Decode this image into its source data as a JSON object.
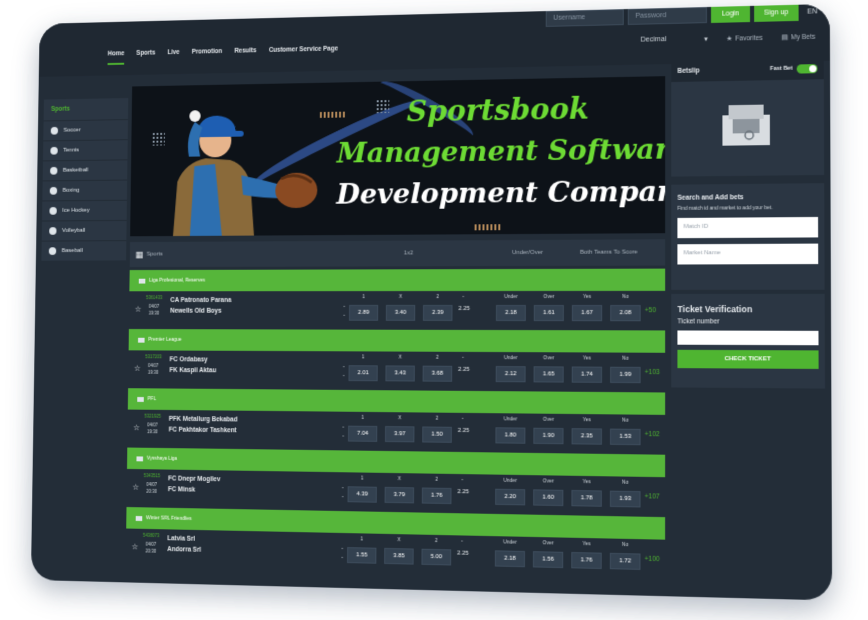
{
  "header": {
    "username_placeholder": "Username",
    "password_placeholder": "Password",
    "login_label": "Login",
    "signup_label": "Sign up",
    "lang": "EN",
    "nav": [
      "Home",
      "Sports",
      "Live",
      "Promotion",
      "Results",
      "Customer Service Page"
    ],
    "odds_format": "Decimal",
    "favorites_label": "Favorites",
    "mybets_label": "My Bets"
  },
  "sidebar": {
    "title": "Sports",
    "items": [
      {
        "label": "Soccer",
        "icon": "soccer-ball-icon"
      },
      {
        "label": "Tennis",
        "icon": "tennis-ball-icon"
      },
      {
        "label": "Basketball",
        "icon": "basketball-icon"
      },
      {
        "label": "Boxing",
        "icon": "boxing-glove-icon"
      },
      {
        "label": "Ice Hockey",
        "icon": "hockey-icon"
      },
      {
        "label": "Volleyball",
        "icon": "volleyball-icon"
      },
      {
        "label": "Baseball",
        "icon": "baseball-icon"
      }
    ]
  },
  "banner": {
    "line1": "Sportsbook",
    "line2": "Management Software",
    "line3": "Development Company"
  },
  "table": {
    "sports_label": "Sports",
    "col_1x2": "1x2",
    "col_under_over": "Under/Over",
    "col_both": "Both Teams To Score",
    "odd_labels": [
      "1",
      "X",
      "2"
    ],
    "uo_labels": [
      "Under",
      "Over"
    ],
    "bt_labels": [
      "Yes",
      "No"
    ],
    "matches": [
      {
        "league": "Liga Profesional, Reserves",
        "code": "5361433",
        "date": "04/07",
        "time": "19:30",
        "home": "CA Patronato Parana",
        "away": "Newells Old Boys",
        "o1": "2.89",
        "ox": "3.40",
        "o2": "2.39",
        "line": "2.25",
        "under": "2.18",
        "over": "1.61",
        "yes": "1.67",
        "no": "2.08",
        "more": "+50"
      },
      {
        "league": "Premier League",
        "code": "5317203",
        "date": "04/07",
        "time": "19:30",
        "home": "FC Ordabasy",
        "away": "FK Kaspii Aktau",
        "o1": "2.01",
        "ox": "3.43",
        "o2": "3.68",
        "line": "2.25",
        "under": "2.12",
        "over": "1.65",
        "yes": "1.74",
        "no": "1.99",
        "more": "+103"
      },
      {
        "league": "PFL",
        "code": "5321925",
        "date": "04/07",
        "time": "19:30",
        "home": "PFK Metallurg Bekabad",
        "away": "FC Pakhtakor Tashkent",
        "o1": "7.04",
        "ox": "3.97",
        "o2": "1.50",
        "line": "2.25",
        "under": "1.80",
        "over": "1.90",
        "yes": "2.35",
        "no": "1.53",
        "more": "+102"
      },
      {
        "league": "Vysshaya Liga",
        "code": "5343515",
        "date": "04/07",
        "time": "20:30",
        "home": "FC Dnepr Mogilev",
        "away": "FC Minsk",
        "o1": "4.39",
        "ox": "3.79",
        "o2": "1.76",
        "line": "2.25",
        "under": "2.20",
        "over": "1.60",
        "yes": "1.78",
        "no": "1.93",
        "more": "+107"
      },
      {
        "league": "Winter SRL Friendlies",
        "code": "5438073",
        "date": "04/07",
        "time": "20:30",
        "home": "Latvia Srl",
        "away": "Andorra Srl",
        "o1": "1.55",
        "ox": "3.85",
        "o2": "5.00",
        "line": "2.25",
        "under": "2.18",
        "over": "1.56",
        "yes": "1.76",
        "no": "1.72",
        "more": "+100"
      }
    ]
  },
  "betslip": {
    "title": "Betslip",
    "fast_bet": "Fast Bet"
  },
  "search": {
    "title": "Search and Add bets",
    "subtitle": "Find match id and market to add your bet.",
    "match_placeholder": "Match ID",
    "market_placeholder": "Market Name"
  },
  "ticket": {
    "title": "Ticket Verification",
    "label": "Ticket number",
    "button": "CHECK TICKET"
  },
  "colors": {
    "accent": "#4fb531",
    "panel": "#2b3643",
    "bg": "#232d38"
  }
}
